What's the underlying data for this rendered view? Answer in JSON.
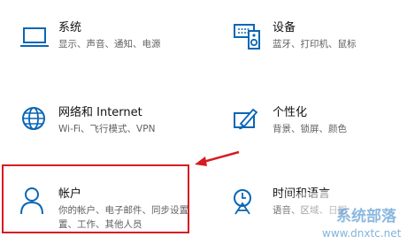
{
  "tiles": {
    "system": {
      "title": "系统",
      "desc1": "显示、声音、通知、电源",
      "icon": "laptop-icon"
    },
    "devices": {
      "title": "设备",
      "desc1": "蓝牙、打印机、鼠标",
      "icon": "keyboard-speaker-icon"
    },
    "network": {
      "title": "网络和 Internet",
      "desc1": "Wi-Fi、飞行模式、VPN",
      "icon": "globe-icon"
    },
    "personal": {
      "title": "个性化",
      "desc1": "背景、锁屏、颜色",
      "icon": "paint-brush-icon"
    },
    "accounts": {
      "title": "帐户",
      "desc1": "你的帐户、电子邮件、同步设置",
      "desc2": "置、工作、其他人员",
      "icon": "person-icon"
    },
    "time": {
      "title": "时间和语言",
      "desc1": "语音、区域、日期",
      "icon": "time-language-icon"
    }
  },
  "watermark": {
    "text": "www.dnxtc.net",
    "brand": "系统部落"
  },
  "colors": {
    "accent": "#0a66b5",
    "highlight": "#d71b22"
  }
}
